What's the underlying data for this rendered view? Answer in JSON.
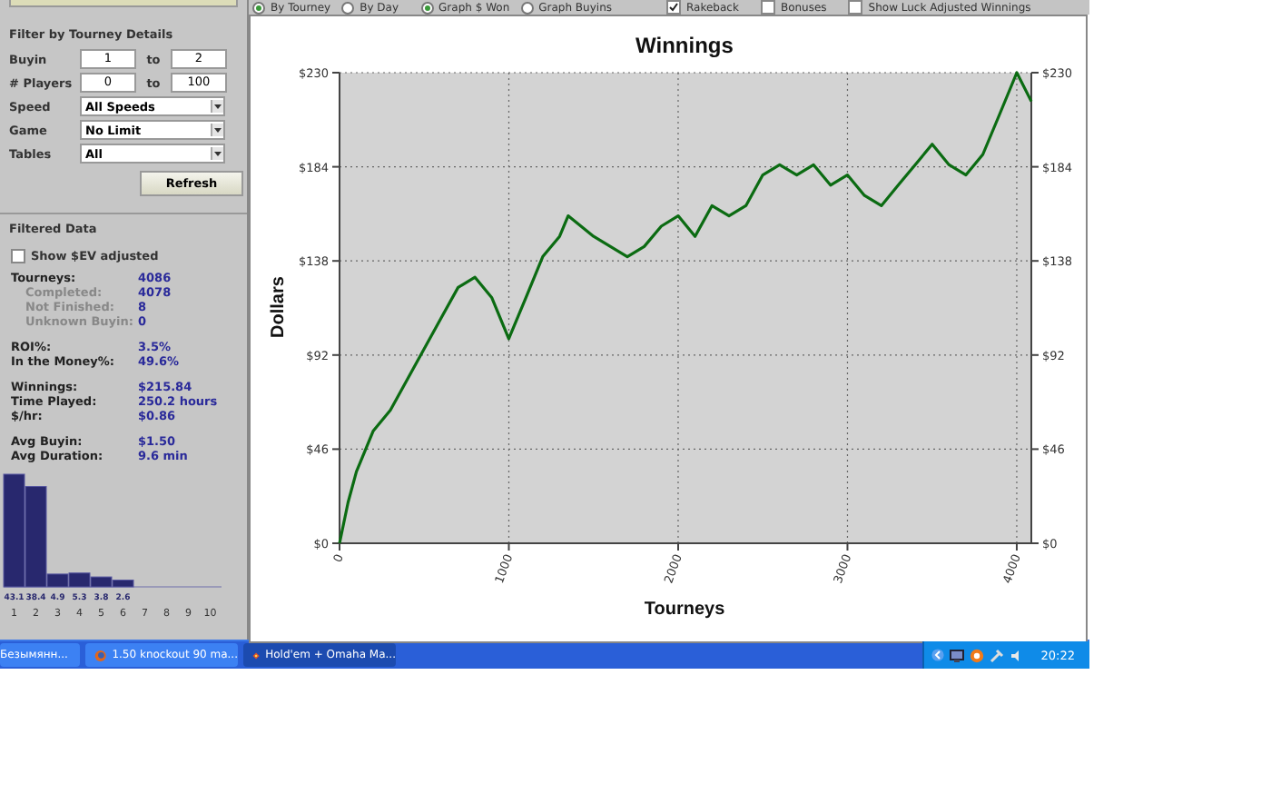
{
  "filter_panel": {
    "title": "Filter by Tourney Details",
    "ranges": [
      {
        "label": "Buyin",
        "from": "1",
        "to_label": "to",
        "to": "2"
      },
      {
        "label": "# Players",
        "from": "0",
        "to_label": "to",
        "to": "100"
      }
    ],
    "dropdowns": [
      {
        "label": "Speed",
        "value": "All Speeds"
      },
      {
        "label": "Game",
        "value": "No Limit"
      },
      {
        "label": "Tables",
        "value": "All"
      }
    ],
    "refresh_button": "Refresh"
  },
  "filtered_data": {
    "title": "Filtered Data",
    "ev_checkbox": {
      "label": "Show $EV adjusted",
      "checked": false
    },
    "stat_groups": [
      [
        {
          "label": "Tourneys:",
          "value": "4086",
          "kind": "main"
        },
        {
          "label": "Completed:",
          "value": "4078",
          "kind": "sub"
        },
        {
          "label": "Not Finished:",
          "value": "8",
          "kind": "sub"
        },
        {
          "label": "Unknown Buyin:",
          "value": "0",
          "kind": "sub"
        }
      ],
      [
        {
          "label": "ROI%:",
          "value": "3.5%",
          "kind": "main"
        },
        {
          "label": "In the Money%:",
          "value": "49.6%",
          "kind": "main"
        }
      ],
      [
        {
          "label": "Winnings:",
          "value": "$215.84",
          "kind": "main"
        },
        {
          "label": "Time Played:",
          "value": "250.2 hours",
          "kind": "main"
        },
        {
          "label": "$/hr:",
          "value": "$0.86",
          "kind": "main"
        }
      ],
      [
        {
          "label": "Avg Buyin:",
          "value": "$1.50",
          "kind": "main"
        },
        {
          "label": "Avg Duration:",
          "value": "9.6 min",
          "kind": "main"
        }
      ]
    ]
  },
  "histogram": {
    "chart_data": {
      "type": "bar",
      "categories": [
        "1",
        "2",
        "3",
        "4",
        "5",
        "6",
        "7",
        "8",
        "9",
        "10"
      ],
      "values": [
        43.1,
        38.4,
        4.9,
        5.3,
        3.8,
        2.6,
        null,
        null,
        null,
        null
      ],
      "data_labels": true
    }
  },
  "toolbar": {
    "radio_groups": [
      [
        {
          "label": "By Tourney",
          "selected": true
        },
        {
          "label": "By Day",
          "selected": false
        }
      ],
      [
        {
          "label": "Graph $ Won",
          "selected": true
        },
        {
          "label": "Graph Buyins",
          "selected": false
        }
      ]
    ],
    "checkboxes": [
      {
        "label": "Rakeback",
        "checked": true
      },
      {
        "label": "Bonuses",
        "checked": false
      },
      {
        "label": "Show Luck Adjusted Winnings",
        "checked": false
      }
    ]
  },
  "graph": {
    "chart_data": {
      "type": "line",
      "title": "Winnings",
      "xlabel": "Tourneys",
      "ylabel": "Dollars",
      "x": [
        0,
        50,
        100,
        200,
        300,
        400,
        500,
        600,
        700,
        800,
        900,
        1000,
        1100,
        1200,
        1300,
        1350,
        1500,
        1600,
        1700,
        1800,
        1900,
        2000,
        2100,
        2200,
        2300,
        2400,
        2500,
        2600,
        2700,
        2800,
        2900,
        3000,
        3100,
        3200,
        3300,
        3400,
        3500,
        3600,
        3700,
        3800,
        3900,
        4000,
        4086
      ],
      "series": [
        {
          "color": "#0b6b12",
          "values": [
            0,
            20,
            35,
            55,
            65,
            80,
            95,
            110,
            125,
            130,
            120,
            100,
            120,
            140,
            150,
            160,
            150,
            145,
            140,
            145,
            155,
            160,
            150,
            165,
            160,
            165,
            180,
            185,
            180,
            185,
            175,
            180,
            170,
            165,
            175,
            185,
            195,
            185,
            180,
            190,
            210,
            230,
            216
          ]
        }
      ],
      "grid": true,
      "xlim": [
        0,
        4086
      ],
      "ylim": [
        0,
        230
      ],
      "xticks": [
        0,
        1000,
        2000,
        3000,
        4000
      ],
      "yticks": [
        {
          "value": 0,
          "label": "$0"
        },
        {
          "value": 46,
          "label": "$46"
        },
        {
          "value": 92,
          "label": "$92"
        },
        {
          "value": 138,
          "label": "$138"
        },
        {
          "value": 184,
          "label": "$184"
        },
        {
          "value": 230,
          "label": "$230"
        }
      ]
    }
  },
  "taskbar": {
    "items": [
      {
        "label": "Безымянн...",
        "selected": false,
        "kind": "plain"
      },
      {
        "label": "1.50 knockout 90 ma...",
        "selected": false,
        "kind": "browser"
      },
      {
        "label": "Hold'em + Omaha Ma...",
        "selected": true,
        "kind": "app"
      }
    ],
    "clock": "20:22"
  }
}
